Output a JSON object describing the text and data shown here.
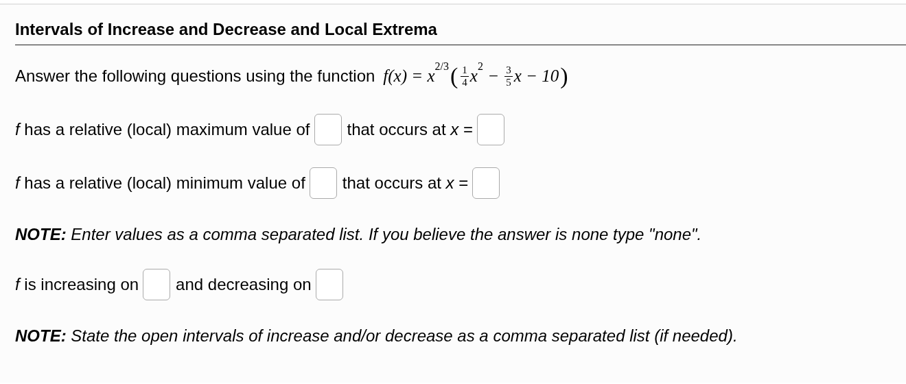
{
  "title": "Intervals of Increase and Decrease and Local Extrema",
  "rows": [
    {
      "kind": "prompt",
      "items": [
        {
          "kind": "text",
          "text": "Answer the following questions using the function"
        },
        {
          "kind": "formula",
          "parts": [
            {
              "kind": "math",
              "text": "f(x) = x"
            },
            {
              "kind": "sup",
              "text": "2/3"
            },
            {
              "kind": "paren",
              "text": "("
            },
            {
              "kind": "frac",
              "num": "1",
              "den": "4"
            },
            {
              "kind": "math",
              "text": "x"
            },
            {
              "kind": "sup",
              "text": "2"
            },
            {
              "kind": "math",
              "text": " − "
            },
            {
              "kind": "frac",
              "num": "3",
              "den": "5"
            },
            {
              "kind": "math",
              "text": "x − 10"
            },
            {
              "kind": "paren",
              "text": ")"
            }
          ]
        }
      ]
    },
    {
      "kind": "question",
      "items": [
        {
          "kind": "text",
          "text": "*f* has a relative (local) maximum value of"
        },
        {
          "kind": "input"
        },
        {
          "kind": "text",
          "text": "that occurs at *x* ="
        },
        {
          "kind": "input"
        }
      ]
    },
    {
      "kind": "question",
      "items": [
        {
          "kind": "text",
          "text": "*f* has a relative (local) minimum value of"
        },
        {
          "kind": "input"
        },
        {
          "kind": "text",
          "text": "that occurs at *x* ="
        },
        {
          "kind": "input"
        }
      ]
    },
    {
      "kind": "note",
      "items": [
        {
          "kind": "text",
          "text": "**NOTE:** Enter values as a comma separated list. If you believe the answer is none type \"none\"."
        }
      ]
    },
    {
      "kind": "question",
      "items": [
        {
          "kind": "text",
          "text": "*f* is increasing on"
        },
        {
          "kind": "input"
        },
        {
          "kind": "text",
          "text": "and decreasing on"
        },
        {
          "kind": "input"
        }
      ]
    },
    {
      "kind": "note",
      "items": [
        {
          "kind": "text",
          "text": "**NOTE:** State the open intervals of increase and/or decrease as a comma separated list (if needed)."
        }
      ]
    }
  ]
}
